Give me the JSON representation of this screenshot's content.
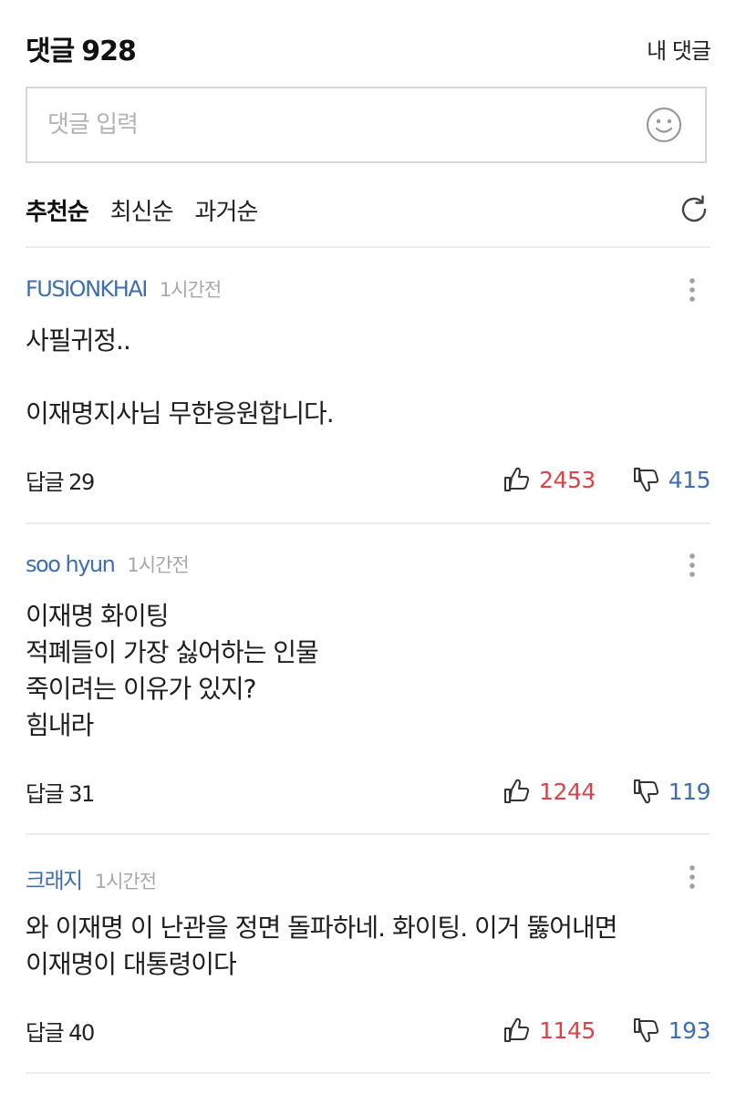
{
  "header": {
    "title": "댓글",
    "count": "928",
    "my_comments_label": "내 댓글"
  },
  "input": {
    "placeholder": "댓글 입력",
    "emoji_icon": "smile-icon"
  },
  "sort": {
    "tabs": [
      "추천순",
      "최신순",
      "과거순"
    ],
    "active": "추천순",
    "refresh_icon": "refresh-icon"
  },
  "colors": {
    "author": "#3d6fb0",
    "like": "#d9434a",
    "dislike": "#3d6fb0"
  },
  "comments": [
    {
      "author": "FUSIONKHAI",
      "time": "1시간전",
      "text": "사필귀정..\n\n이재명지사님 무한응원합니다.",
      "reply_label": "답글",
      "reply_count": "29",
      "likes": "2453",
      "dislikes": "415"
    },
    {
      "author": "soo hyun",
      "time": "1시간전",
      "text": "이재명 화이팅\n적폐들이 가장 싫어하는 인물\n죽이려는 이유가 있지?\n힘내라",
      "reply_label": "답글",
      "reply_count": "31",
      "likes": "1244",
      "dislikes": "119"
    },
    {
      "author": "크래지",
      "time": "1시간전",
      "text": "와 이재명 이 난관을 정면 돌파하네. 화이팅. 이거 뚫어내면\n이재명이 대통령이다",
      "reply_label": "답글",
      "reply_count": "40",
      "likes": "1145",
      "dislikes": "193"
    }
  ]
}
